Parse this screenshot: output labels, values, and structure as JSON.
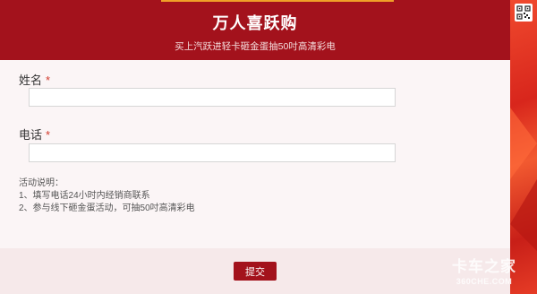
{
  "header": {
    "title": "万人喜跃购",
    "subtitle": "买上汽跃进轻卡砸金蛋抽50吋高清彩电"
  },
  "form": {
    "name_label": "姓名",
    "phone_label": "电话",
    "required_mark": "*",
    "name_value": "",
    "phone_value": ""
  },
  "notes": {
    "heading": "活动说明：",
    "items": [
      "1、填写电话24小时内经销商联系",
      "2、参与线下砸金蛋活动，可抽50吋高清彩电"
    ]
  },
  "footer": {
    "submit_label": "提交"
  },
  "watermark": {
    "brand": "卡车之家",
    "domain": "360CHE.COM"
  },
  "icons": {
    "qr": "qr-code-icon"
  },
  "colors": {
    "brand_red": "#a3121c",
    "required": "#d23a2c"
  }
}
